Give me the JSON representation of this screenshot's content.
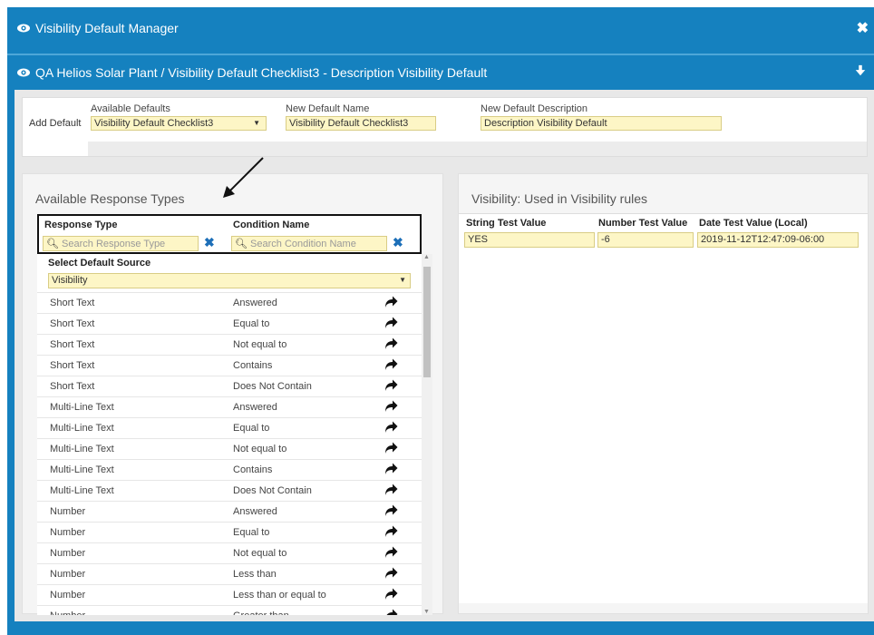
{
  "window": {
    "title": "Visibility Default Manager",
    "breadcrumb": "QA Helios Solar Plant / Visibility Default Checklist3 - Description Visibility Default"
  },
  "add_default": {
    "label": "Add Default",
    "available_defaults_label": "Available Defaults",
    "available_defaults_value": "Visibility Default Checklist3",
    "new_name_label": "New Default Name",
    "new_name_value": "Visibility Default Checklist3",
    "new_description_label": "New Default Description",
    "new_description_value": "Description Visibility Default"
  },
  "left_panel": {
    "title": "Available Response Types",
    "col_response_type": "Response Type",
    "col_condition_name": "Condition Name",
    "search_response_placeholder": "Search Response Type",
    "search_condition_placeholder": "Search Condition Name",
    "select_default_source_label": "Select Default Source",
    "select_default_source_value": "Visibility",
    "rows": [
      {
        "type": "Short Text",
        "condition": "Answered"
      },
      {
        "type": "Short Text",
        "condition": "Equal to"
      },
      {
        "type": "Short Text",
        "condition": "Not equal to"
      },
      {
        "type": "Short Text",
        "condition": "Contains"
      },
      {
        "type": "Short Text",
        "condition": "Does Not Contain"
      },
      {
        "type": "Multi-Line Text",
        "condition": "Answered"
      },
      {
        "type": "Multi-Line Text",
        "condition": "Equal to"
      },
      {
        "type": "Multi-Line Text",
        "condition": "Not equal to"
      },
      {
        "type": "Multi-Line Text",
        "condition": "Contains"
      },
      {
        "type": "Multi-Line Text",
        "condition": "Does Not Contain"
      },
      {
        "type": "Number",
        "condition": "Answered"
      },
      {
        "type": "Number",
        "condition": "Equal to"
      },
      {
        "type": "Number",
        "condition": "Not equal to"
      },
      {
        "type": "Number",
        "condition": "Less than"
      },
      {
        "type": "Number",
        "condition": "Less than or equal to"
      },
      {
        "type": "Number",
        "condition": "Greater than"
      }
    ]
  },
  "right_panel": {
    "title": "Visibility: Used in Visibility rules",
    "col_string": "String Test Value",
    "col_number": "Number Test Value",
    "col_date": "Date Test Value (Local)",
    "string_value": "YES",
    "number_value": "-6",
    "date_value": "2019-11-12T12:47:09-06:00"
  },
  "colors": {
    "header_blue": "#1581bf",
    "input_yellow": "#fdf6c6",
    "link_blue": "#1d6fb8"
  }
}
